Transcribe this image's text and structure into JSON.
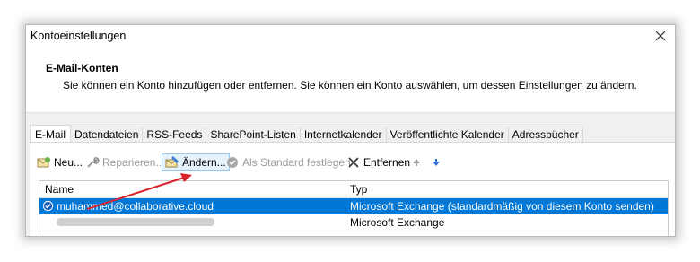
{
  "window": {
    "title": "Kontoeinstellungen"
  },
  "header": {
    "title": "E-Mail-Konten",
    "description": "Sie können ein Konto hinzufügen oder entfernen. Sie können ein Konto auswählen, um dessen Einstellungen zu ändern."
  },
  "tabs": [
    {
      "label": "E-Mail",
      "active": true
    },
    {
      "label": "Datendateien"
    },
    {
      "label": "RSS-Feeds"
    },
    {
      "label": "SharePoint-Listen"
    },
    {
      "label": "Internetkalender"
    },
    {
      "label": "Veröffentlichte Kalender"
    },
    {
      "label": "Adressbücher"
    }
  ],
  "toolbar": {
    "new_label": "Neu...",
    "repair_label": "Reparieren...",
    "change_label": "Ändern...",
    "set_default_label": "Als Standard festlegen",
    "remove_label": "Entfernen",
    "move_up_icon": "arrow-up-icon",
    "move_down_icon": "arrow-down-icon"
  },
  "accounts_list": {
    "columns": {
      "name": "Name",
      "type": "Typ"
    },
    "rows": [
      {
        "name": "muhammed@collaborative.cloud",
        "type": "Microsoft Exchange (standardmäßig von diesem Konto senden)",
        "selected": true,
        "default": true
      },
      {
        "name": "",
        "type": "Microsoft Exchange",
        "selected": false,
        "name_obscured": true
      }
    ]
  },
  "colors": {
    "selection": "#0078d7",
    "annotation_arrow": "#d9232d",
    "highlight_button": "#e5f1fb"
  }
}
